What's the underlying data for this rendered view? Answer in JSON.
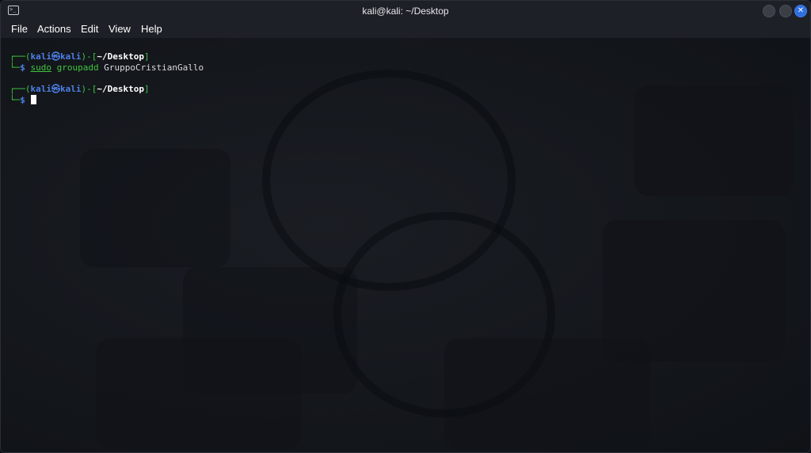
{
  "window": {
    "title": "kali@kali: ~/Desktop"
  },
  "menu": {
    "items": [
      "File",
      "Actions",
      "Edit",
      "View",
      "Help"
    ]
  },
  "terminal": {
    "prompt1": {
      "bracket_open": "┌──(",
      "user": "kali",
      "at_symbol": "㉿",
      "host": "kali",
      "bracket_mid": ")-[",
      "path": "~/Desktop",
      "bracket_close": "]",
      "corner": "└─",
      "dollar": "$",
      "cmd_sudo": "sudo",
      "cmd_name": "groupadd",
      "cmd_arg": "GruppoCristianGallo"
    },
    "prompt2": {
      "bracket_open": "┌──(",
      "user": "kali",
      "at_symbol": "㉿",
      "host": "kali",
      "bracket_mid": ")-[",
      "path": "~/Desktop",
      "bracket_close": "]",
      "corner": "└─",
      "dollar": "$"
    }
  },
  "colors": {
    "prompt_green": "#3fc53f",
    "prompt_blue": "#4d7fe6",
    "close_button": "#2f6fe0",
    "background": "#13161c"
  }
}
